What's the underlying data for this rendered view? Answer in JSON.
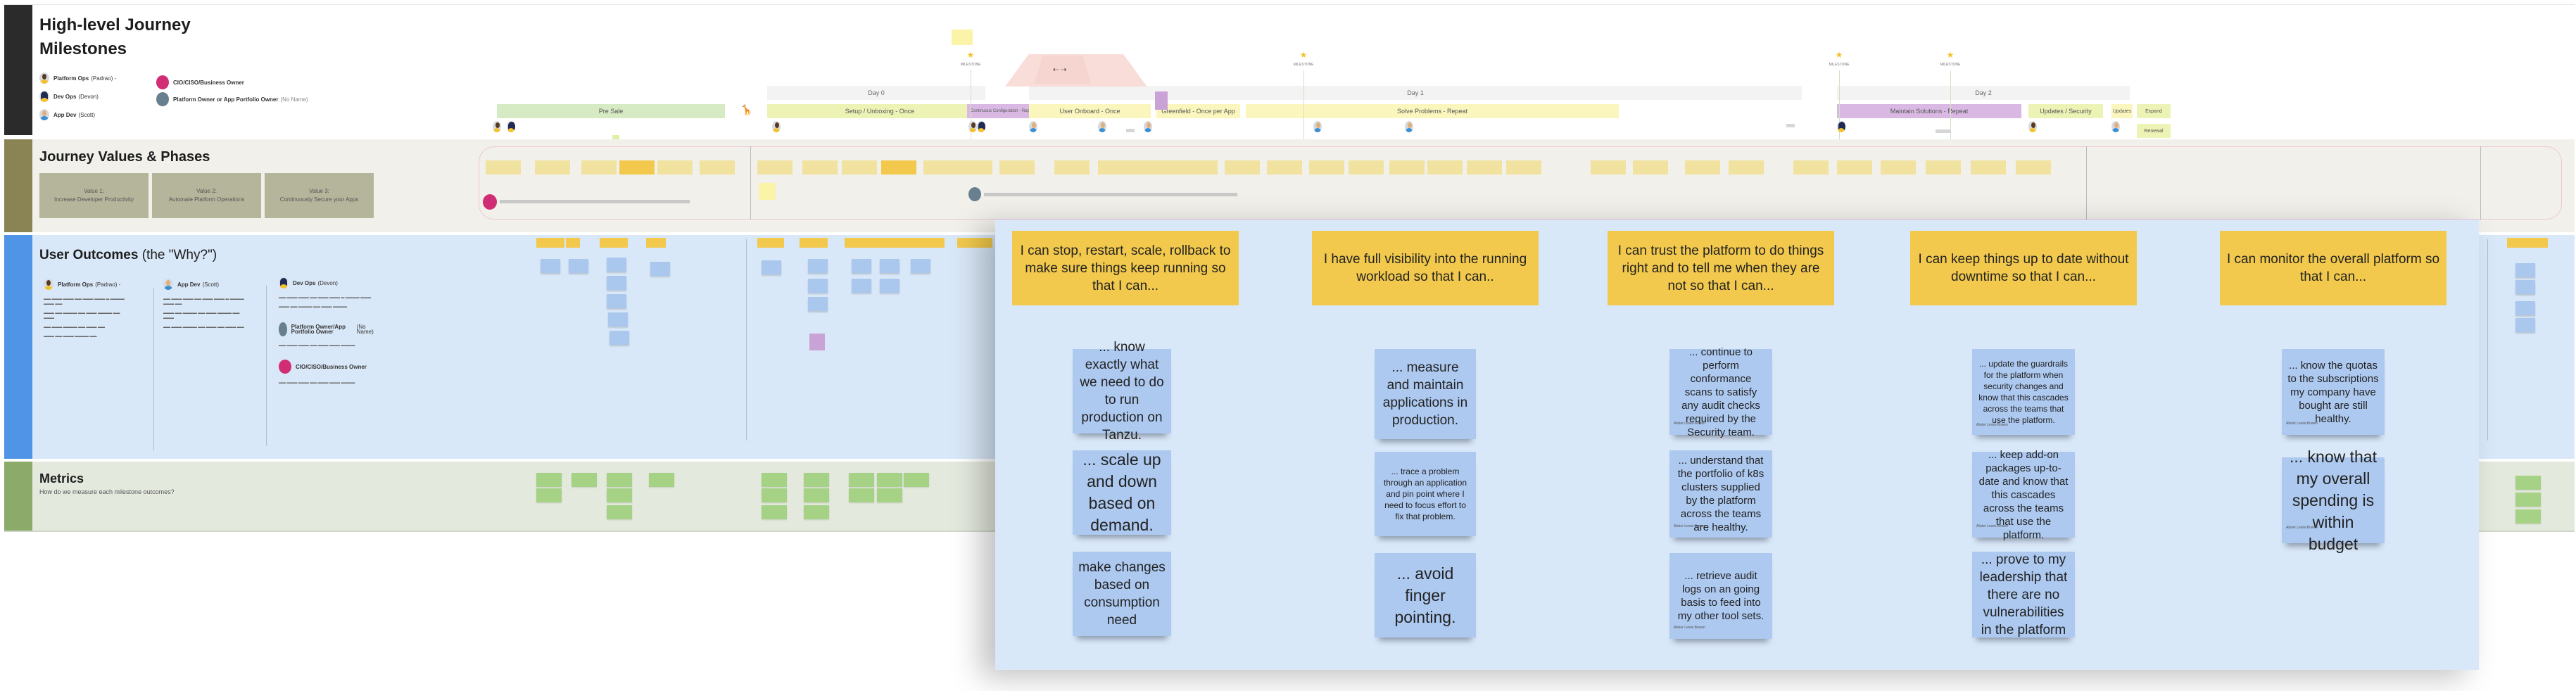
{
  "board": {
    "lanes": {
      "milestones": {
        "title_line1": "High-level Journey",
        "title_line2": "Milestones"
      },
      "values": {
        "title": "Journey Values &  Phases"
      },
      "outcomes": {
        "title": "User Outcomes",
        "title_suffix": "(the \"Why?\")"
      },
      "metrics": {
        "title": "Metrics",
        "subtitle": "How do we measure each milestone outcomes?"
      }
    },
    "personas_legend": [
      {
        "name": "Platform Ops",
        "alias": "(Padrao) -",
        "icon": "platform-ops-avatar"
      },
      {
        "name": "Dev Ops",
        "alias": "(Devon)",
        "icon": "dev-ops-avatar"
      },
      {
        "name": "App Dev",
        "alias": "(Scott)",
        "icon": "app-dev-avatar"
      },
      {
        "name": "CIO/CISO/Business Owner",
        "alias": "",
        "icon": "cio-dot"
      },
      {
        "name": "Platform Owner or App Portfolio Owner",
        "alias": "(No Name)",
        "icon": "owner-dot"
      }
    ],
    "days": [
      "Day 0",
      "Day 1",
      "Day 2"
    ],
    "phases": [
      "Pre Sale",
      "Setup / Unboxing - Once",
      "Continuous Configuration - Repeat",
      "User Onboard - Once",
      "Greenfield - Once per App",
      "Solve Problems - Repeat",
      "Maintain Solutions - Repeat",
      "Updates / Security",
      "Updates",
      "Expand",
      "Renewal"
    ],
    "milestone_label": "MILESTONE",
    "values": [
      {
        "label": "Value 1:",
        "text": "Increase Developer Productivity"
      },
      {
        "label": "Value 2:",
        "text": "Automate Platform Operations"
      },
      {
        "label": "Value 3:",
        "text": "Continuously Secure your Apps"
      }
    ],
    "outcome_personas": [
      {
        "name": "Platform Ops",
        "alias": "(Padrao) -"
      },
      {
        "name": "App Dev",
        "alias": "(Scott)"
      },
      {
        "name": "Dev Ops",
        "alias": "(Devon)"
      },
      {
        "name": "Platform Owner/App Portfolio Owner",
        "alias": "(No Name)"
      },
      {
        "name": "CIO/CISO/Business Owner",
        "alias": ""
      }
    ],
    "zoom_panel": {
      "columns": [
        {
          "headline": "I can stop, restart, scale, rollback to make sure things keep running so that I can...",
          "notes": [
            {
              "text": "... know exactly what we need to do to run production on Tanzu.",
              "author": ""
            },
            {
              "text": "... scale up and down based on demand.",
              "author": ""
            },
            {
              "text": "make changes based on consumption need",
              "author": ""
            }
          ]
        },
        {
          "headline": "I have full visibility into the running workload so that I can..",
          "notes": [
            {
              "text": "... measure and maintain applications in production.",
              "author": ""
            },
            {
              "text": "... trace a problem through an application and pin point where I need to focus effort to fix that problem.",
              "author": ""
            },
            {
              "text": "... avoid finger pointing.",
              "author": ""
            }
          ]
        },
        {
          "headline": "I can trust the platform to do things right and to tell me when they are not so that I can...",
          "notes": [
            {
              "text": "... continue to perform conformance scans to satisfy any audit checks required by the Security team.",
              "author": "Alister Lewis-Bowen"
            },
            {
              "text": "... understand that the portfolio of k8s clusters supplied by the platform across the teams are healthy.",
              "author": "Alister Lewis-Bowen"
            },
            {
              "text": "... retrieve audit logs on an going basis to feed into my other tool sets.",
              "author": "Alister Lewis-Bowen"
            }
          ]
        },
        {
          "headline": "I can keep things up to date without downtime so that I can...",
          "notes": [
            {
              "text": "... update the guardrails for the platform when security changes and know that this cascades across the teams that use the platform.",
              "author": "Alister Lewis-Bowen"
            },
            {
              "text": "... keep add-on packages up-to-date and know that this cascades across the teams that use the platform.",
              "author": "Alister Lewis-Bowen"
            },
            {
              "text": "... prove to my leadership that there are no vulnerabilities in the platform",
              "author": ""
            }
          ]
        },
        {
          "headline": "I can monitor the overall platform so that I can...",
          "notes": [
            {
              "text": "... know the quotas to the subscriptions my company have bought are still healthy.",
              "author": "Alister Lewis-Bowen"
            },
            {
              "text": "... know that my overall spending is within budget",
              "author": "Alister Lewis-Bowen"
            }
          ]
        }
      ]
    },
    "colors": {
      "milestones_bar": "#2b2b2b",
      "values_bar": "#8a8455",
      "outcomes_bar": "#4f94e6",
      "metrics_bar": "#8cab6a",
      "headline_sticky": "#f2c94c",
      "outcome_sticky": "#adc9f0",
      "metric_sticky": "#a6d286",
      "cio": "#d12d74",
      "owner": "#687f8f"
    }
  }
}
